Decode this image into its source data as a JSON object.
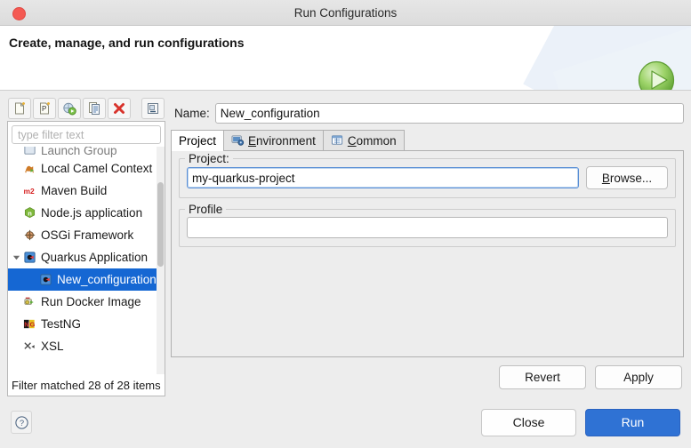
{
  "window": {
    "title": "Run Configurations",
    "close_icon": "close-dot-icon"
  },
  "header": {
    "title": "Create, manage, and run configurations",
    "icon": "run-play-icon"
  },
  "toolbar": {
    "buttons": [
      {
        "name": "new-launch-configuration-button",
        "icon": "new-document-icon"
      },
      {
        "name": "new-prototype-button",
        "icon": "new-prototype-icon"
      },
      {
        "name": "export-launch-configuration-button",
        "icon": "export-run-icon"
      },
      {
        "name": "duplicate-button",
        "icon": "duplicate-icon"
      },
      {
        "name": "delete-button",
        "icon": "delete-x-icon"
      },
      {
        "name": "collapse-all-button",
        "icon": "collapse-all-icon"
      }
    ]
  },
  "filter": {
    "placeholder": "type filter text",
    "value": "",
    "status": "Filter matched 28 of 28 items"
  },
  "tree": {
    "items": [
      {
        "label": "Launch Group",
        "icon": "launch-group-icon",
        "indent": "root",
        "clipped": true,
        "selected": false
      },
      {
        "label": "Local Camel Context",
        "icon": "camel-icon",
        "indent": "root",
        "clipped": false,
        "selected": false
      },
      {
        "label": "Maven Build",
        "icon": "maven-m2-icon",
        "indent": "root",
        "clipped": false,
        "selected": false
      },
      {
        "label": "Node.js application",
        "icon": "nodejs-icon",
        "indent": "root",
        "clipped": false,
        "selected": false
      },
      {
        "label": "OSGi Framework",
        "icon": "osgi-icon",
        "indent": "root",
        "clipped": false,
        "selected": false
      },
      {
        "label": "Quarkus Application",
        "icon": "quarkus-icon",
        "indent": "root",
        "clipped": false,
        "selected": false,
        "expanded": true
      },
      {
        "label": "New_configuration",
        "icon": "quarkus-icon",
        "indent": "child",
        "clipped": false,
        "selected": true
      },
      {
        "label": "Run Docker Image",
        "icon": "docker-run-icon",
        "indent": "root",
        "clipped": false,
        "selected": false
      },
      {
        "label": "TestNG",
        "icon": "testng-icon",
        "indent": "root",
        "clipped": false,
        "selected": false
      },
      {
        "label": "XSL",
        "icon": "xsl-icon",
        "indent": "root",
        "clipped": false,
        "selected": false
      }
    ]
  },
  "config": {
    "name_label": "Name:",
    "name_value": "New_configuration",
    "tabs": [
      {
        "label": "Project",
        "icon": "",
        "active": true,
        "mnemonic": ""
      },
      {
        "label": "Environment",
        "icon": "environment-icon",
        "active": false,
        "mnemonic": "E"
      },
      {
        "label": "Common",
        "icon": "common-icon",
        "active": false,
        "mnemonic": "C"
      }
    ],
    "project_group_title": "Project:",
    "project_value": "my-quarkus-project",
    "browse_label": "Browse...",
    "browse_mnemonic": "B",
    "profile_group_title": "Profile",
    "profile_value": "",
    "revert_label": "Revert",
    "apply_label": "Apply"
  },
  "footer": {
    "help_icon": "help-question-icon",
    "close_label": "Close",
    "run_label": "Run"
  },
  "colors": {
    "accent_blue": "#2f72d4",
    "selection_blue": "#1567d3",
    "run_icon_green": "#7dc242",
    "close_red": "#f45a53"
  }
}
